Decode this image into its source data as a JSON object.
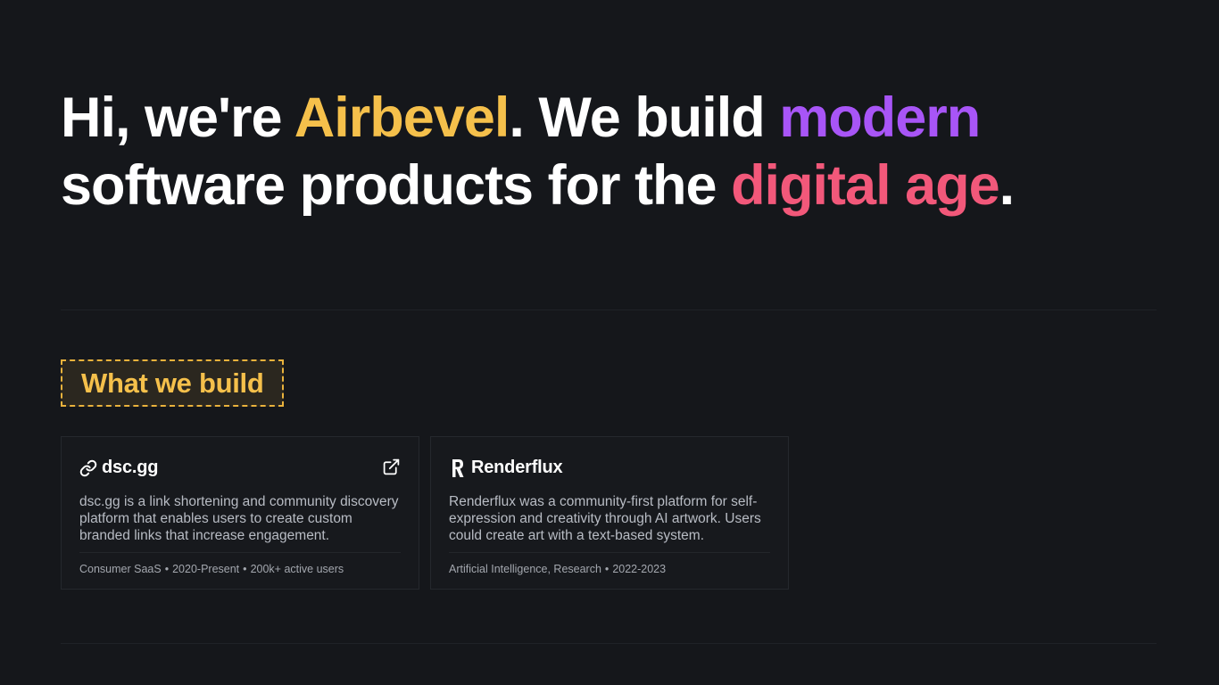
{
  "hero": {
    "prefix": "Hi, we're ",
    "brand": "Airbevel",
    "middle": ". We build ",
    "modern": "modern",
    "line2": " software products for the ",
    "digital": "digital age",
    "end": "."
  },
  "section": {
    "title": "What we build"
  },
  "projects": [
    {
      "name": "dsc.gg",
      "icon": "link-icon",
      "description": "dsc.gg is a link shortening and community discovery platform that enables users to create custom branded links that increase engagement.",
      "meta": [
        "Consumer SaaS",
        "2020-Present",
        "200k+ active users"
      ],
      "external_link_icon": "external-link-icon"
    },
    {
      "name": "Renderflux",
      "icon": "renderflux-logo-icon",
      "description": "Renderflux was a community-first platform for self-expression and creativity through AI artwork. Users could create art with a text-based system.",
      "meta": [
        "Artificial Intelligence, Research",
        "2022-2023"
      ]
    }
  ],
  "colors": {
    "background": "#15171b",
    "brand": "#f5c04b",
    "modern": "#a855f7",
    "digital": "#f2587a"
  },
  "separator": "•"
}
